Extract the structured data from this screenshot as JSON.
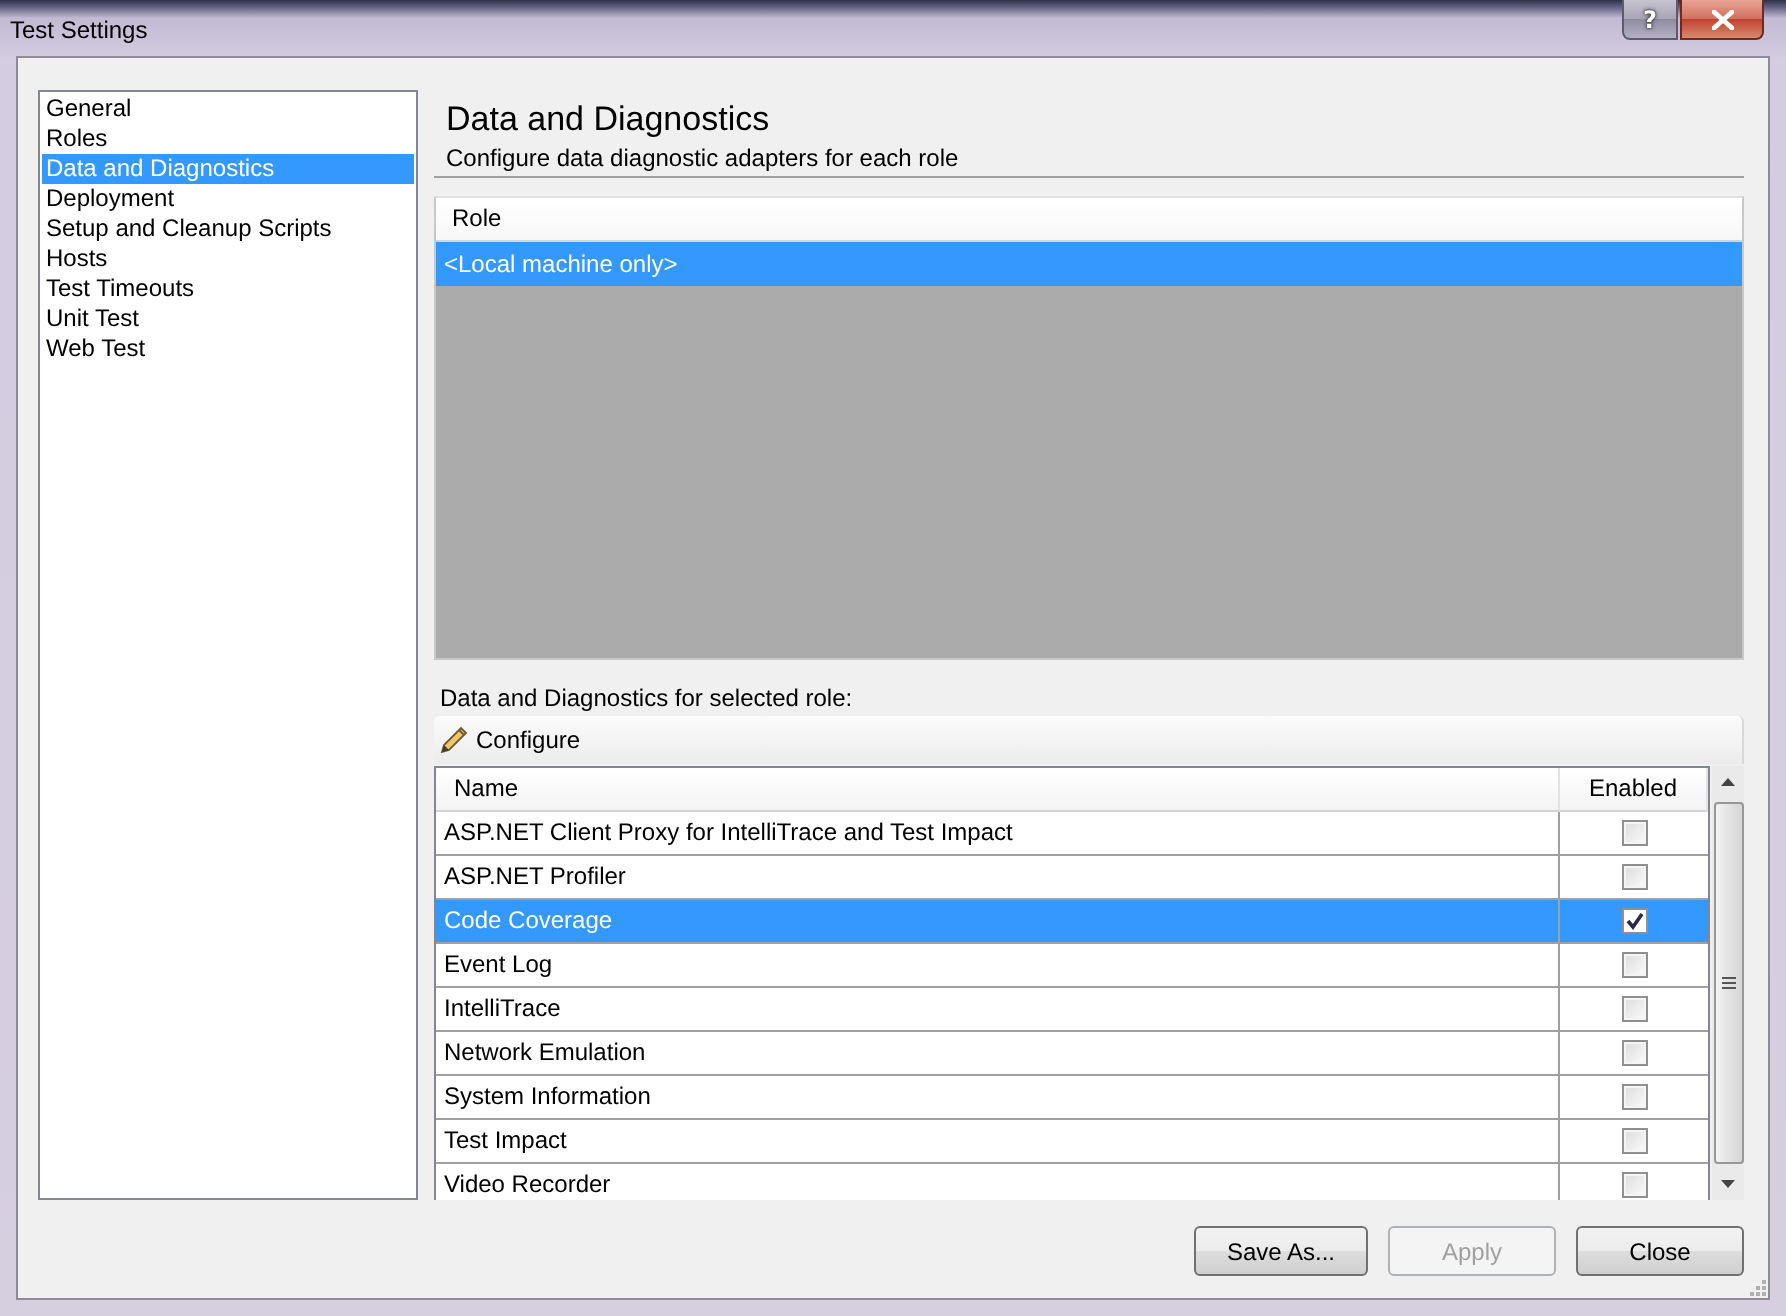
{
  "window": {
    "title": "Test Settings",
    "help_button": "?"
  },
  "sidebar": {
    "items": [
      {
        "label": "General",
        "selected": false
      },
      {
        "label": "Roles",
        "selected": false
      },
      {
        "label": "Data and Diagnostics",
        "selected": true
      },
      {
        "label": "Deployment",
        "selected": false
      },
      {
        "label": "Setup and Cleanup Scripts",
        "selected": false
      },
      {
        "label": "Hosts",
        "selected": false
      },
      {
        "label": "Test Timeouts",
        "selected": false
      },
      {
        "label": "Unit Test",
        "selected": false
      },
      {
        "label": "Web Test",
        "selected": false
      }
    ]
  },
  "header": {
    "title": "Data and Diagnostics",
    "subtitle": "Configure data diagnostic adapters for each role"
  },
  "roles": {
    "columns": [
      "Role"
    ],
    "rows": [
      {
        "name": "<Local machine only>",
        "selected": true
      }
    ]
  },
  "adapters": {
    "label": "Data and Diagnostics for selected role:",
    "toolbar": {
      "configure": "Configure"
    },
    "columns": [
      "Name",
      "Enabled"
    ],
    "rows": [
      {
        "name": "ASP.NET Client Proxy for IntelliTrace and Test Impact",
        "enabled": false,
        "selected": false
      },
      {
        "name": "ASP.NET Profiler",
        "enabled": false,
        "selected": false
      },
      {
        "name": "Code Coverage",
        "enabled": true,
        "selected": true
      },
      {
        "name": "Event Log",
        "enabled": false,
        "selected": false
      },
      {
        "name": "IntelliTrace",
        "enabled": false,
        "selected": false
      },
      {
        "name": "Network Emulation",
        "enabled": false,
        "selected": false
      },
      {
        "name": "System Information",
        "enabled": false,
        "selected": false
      },
      {
        "name": "Test Impact",
        "enabled": false,
        "selected": false
      },
      {
        "name": "Video Recorder",
        "enabled": false,
        "selected": false
      }
    ]
  },
  "buttons": [
    {
      "label": "Save As...",
      "disabled": false
    },
    {
      "label": "Apply",
      "disabled": true
    },
    {
      "label": "Close",
      "disabled": false
    }
  ]
}
